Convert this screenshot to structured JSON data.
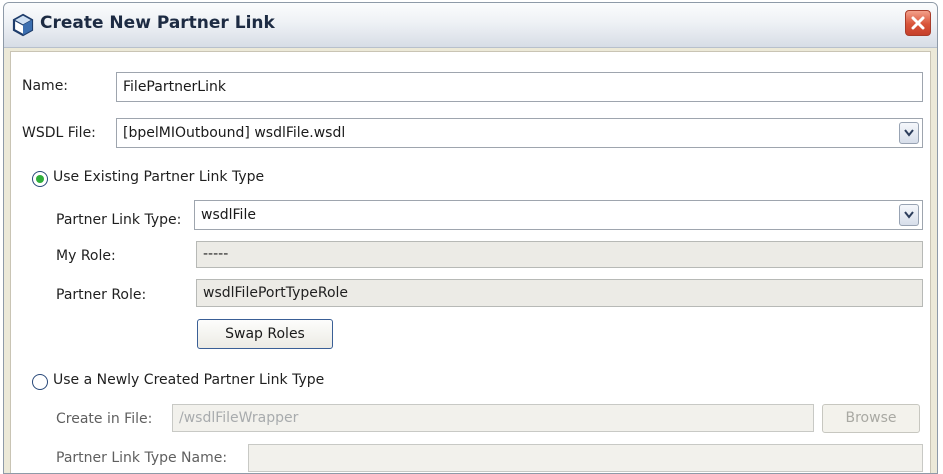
{
  "window": {
    "title": "Create New Partner Link"
  },
  "form": {
    "name_label": "Name:",
    "name_value": "FilePartnerLink",
    "wsdl_label": "WSDL File:",
    "wsdl_value": "[bpelMIOutbound] wsdlFile.wsdl",
    "use_existing": {
      "label": "Use Existing Partner Link Type",
      "selected": true,
      "partner_link_type_label": "Partner Link Type:",
      "partner_link_type_value": "wsdlFile",
      "my_role_label": "My Role:",
      "my_role_value": "-----",
      "partner_role_label": "Partner Role:",
      "partner_role_value": "wsdlFilePortTypeRole",
      "swap_roles_label": "Swap Roles"
    },
    "use_new": {
      "label": "Use a Newly Created Partner Link Type",
      "selected": false,
      "create_in_file_label": "Create in File:",
      "create_in_file_value": "/wsdlFileWrapper",
      "browse_label": "Browse",
      "partner_link_type_name_label": "Partner Link Type Name:"
    }
  },
  "colors": {
    "radio_selected": "#2fae3b",
    "close_button": "#d9543a",
    "button_border": "#3a5f96"
  },
  "icons": {
    "title": "netbeans-cube-icon",
    "close": "close-x-icon",
    "combo": "chevron-down-icon"
  }
}
